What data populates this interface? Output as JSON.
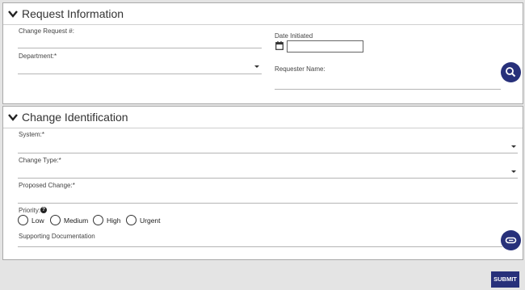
{
  "request_info": {
    "title": "Request Information",
    "change_request_label": "Change Request #:",
    "date_initiated_label": "Date Initiated",
    "date_initiated_value": "",
    "department_label": "Department:*",
    "requester_name_label": "Requester Name:"
  },
  "change_ident": {
    "title": "Change Identification",
    "system_label": "System:*",
    "change_type_label": "Change Type:*",
    "proposed_change_label": "Proposed Change:*",
    "priority_label": "Priority:",
    "priority_help": "?",
    "priority_options": [
      "Low",
      "Medium",
      "High",
      "Urgent"
    ],
    "supporting_doc_label": "Supporting Documentation"
  },
  "submit_label": "SUBMIT",
  "colors": {
    "accent": "#27307a",
    "background": "#e4e4e4"
  },
  "icons": [
    "chevron-down-icon",
    "calendar-icon",
    "search-icon",
    "attachment-icon",
    "help-icon"
  ]
}
